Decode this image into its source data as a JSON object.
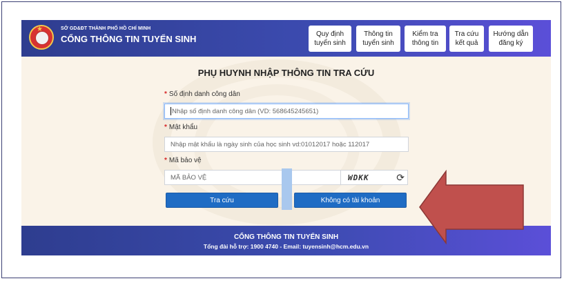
{
  "header": {
    "department": "SỞ GD&ĐT THÀNH PHỐ HỒ CHÍ MINH",
    "title": "CỔNG THÔNG TIN TUYỂN SINH",
    "logo_icon": "school-emblem",
    "nav": [
      {
        "line1": "Quy định",
        "line2": "tuyển sinh"
      },
      {
        "line1": "Thông tin",
        "line2": "tuyển sinh"
      },
      {
        "line1": "Kiểm tra",
        "line2": "thông tin"
      },
      {
        "line1": "Tra cứu",
        "line2": "kết quả"
      },
      {
        "line1": "Hướng dẫn",
        "line2": "đăng ký"
      }
    ]
  },
  "form": {
    "title": "PHỤ HUYNH NHẬP THÔNG TIN TRA CỨU",
    "required_mark": "*",
    "citizen_id": {
      "label": "Số định danh công dân",
      "placeholder": "Nhập số định danh công dân (VD: 568645245651)",
      "value": ""
    },
    "password": {
      "label": "Mật khẩu",
      "placeholder": "Nhập mật khẩu là ngày sinh của học sinh vd:01012017 hoặc 112017",
      "value": ""
    },
    "captcha": {
      "label": "Mã bảo vệ",
      "placeholder": "MÃ BẢO VỆ",
      "value": "",
      "image_text": "WDKK",
      "refresh_icon": "refresh-icon"
    },
    "submit_label": "Tra cứu",
    "no_account_label": "Không có tài khoản"
  },
  "footer": {
    "title": "CỔNG THÔNG TIN TUYỂN SINH",
    "contact": "Tổng đài hỗ trợ: 1900 4740 - Email: tuyensinh@hcm.edu.vn"
  },
  "colors": {
    "header_start": "#2e3d8f",
    "header_end": "#5b4fd8",
    "button": "#1f6cc4",
    "required": "#d62828",
    "annotation_arrow": "#c0504d"
  }
}
